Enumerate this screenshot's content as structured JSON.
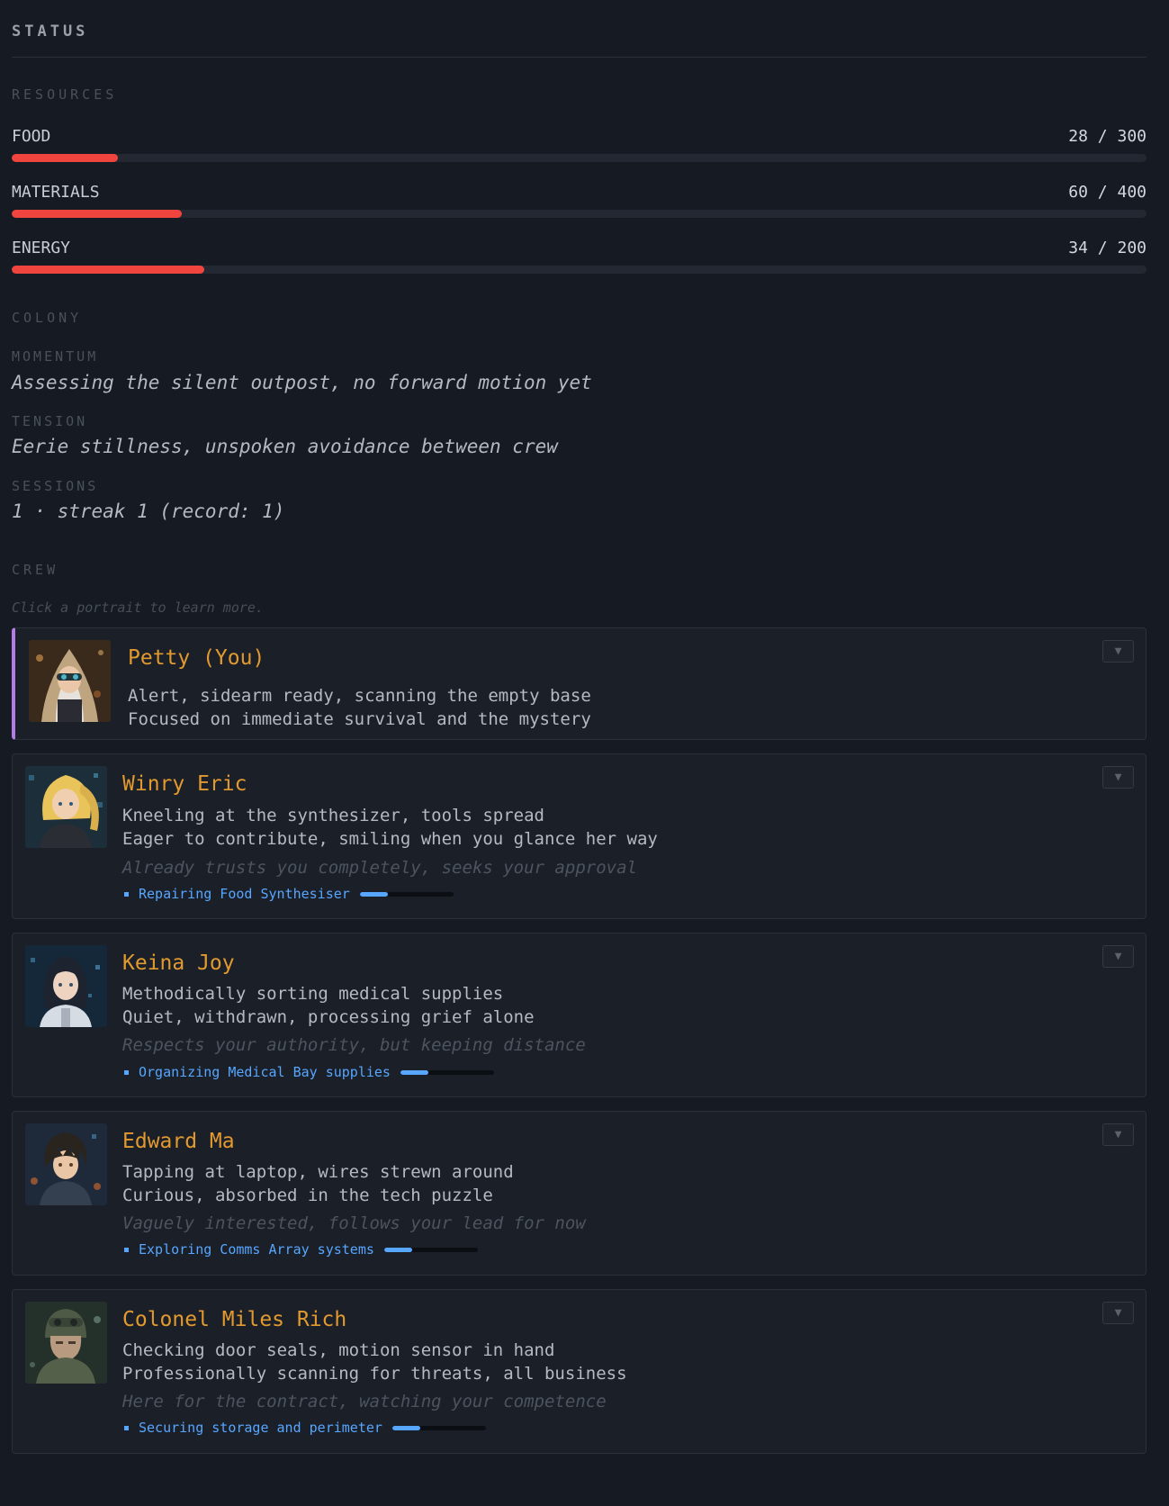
{
  "header": {
    "title": "STATUS"
  },
  "resources": {
    "label": "RESOURCES",
    "items": [
      {
        "name": "FOOD",
        "value_text": "28 / 300",
        "current": 28,
        "max": 300
      },
      {
        "name": "MATERIALS",
        "value_text": "60 / 400",
        "current": 60,
        "max": 400
      },
      {
        "name": "ENERGY",
        "value_text": "34 / 200",
        "current": 34,
        "max": 200
      }
    ],
    "bar_color": "#f0453f"
  },
  "colony": {
    "label": "COLONY",
    "momentum": {
      "label": "MOMENTUM",
      "value": "Assessing the silent outpost, no forward motion yet"
    },
    "tension": {
      "label": "TENSION",
      "value": "Eerie stillness, unspoken avoidance between crew"
    },
    "sessions": {
      "label": "SESSIONS",
      "value": "1 · streak 1 (record: 1)"
    }
  },
  "crew": {
    "label": "CREW",
    "hint": "Click a portrait to learn more.",
    "toggle_icon": "▼",
    "members": [
      {
        "name": "Petty (You)",
        "line1": "Alert, sidearm ready, scanning the empty base",
        "line2": "Focused on immediate survival and the mystery",
        "portrait_icon": "hooded-goggles-portrait"
      },
      {
        "name": "Winry Eric",
        "line1": "Kneeling at the synthesizer, tools spread",
        "line2": "Eager to contribute, smiling when you glance her way",
        "relationship": "Already trusts you completely, seeks your approval",
        "task": "Repairing Food Synthesiser",
        "task_progress": 0.3,
        "portrait_icon": "blonde-ponytail-portrait"
      },
      {
        "name": "Keina Joy",
        "line1": "Methodically sorting medical supplies",
        "line2": "Quiet, withdrawn, processing grief alone",
        "relationship": "Respects your authority, but keeping distance",
        "task": "Organizing Medical Bay supplies",
        "task_progress": 0.3,
        "portrait_icon": "dark-hair-portrait"
      },
      {
        "name": "Edward Ma",
        "line1": "Tapping at laptop, wires strewn around",
        "line2": "Curious, absorbed in the tech puzzle",
        "relationship": "Vaguely interested, follows your lead for now",
        "task": "Exploring Comms Array systems",
        "task_progress": 0.3,
        "portrait_icon": "messy-hair-portrait"
      },
      {
        "name": "Colonel Miles Rich",
        "line1": "Checking door seals, motion sensor in hand",
        "line2": "Professionally scanning for threats, all business",
        "relationship": "Here for the contract, watching your competence",
        "task": "Securing storage and perimeter",
        "task_progress": 0.3,
        "portrait_icon": "helmet-soldier-portrait"
      }
    ]
  },
  "colors": {
    "name_accent": "#e29a2f",
    "task_accent": "#57a6ff",
    "self_marker": "#b57be6",
    "background": "#161a22"
  }
}
